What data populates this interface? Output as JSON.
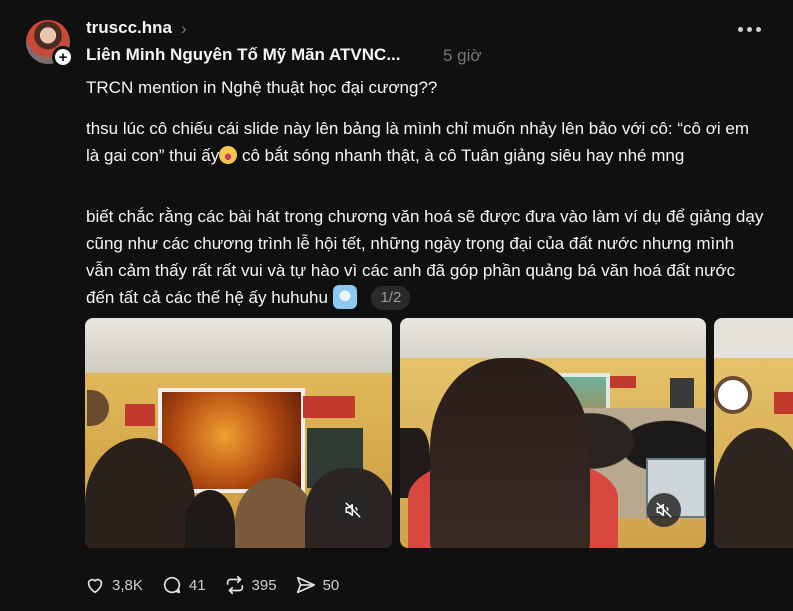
{
  "post": {
    "username": "truscc.hna",
    "community": "Liên Minh Nguyên Tố Mỹ Mãn ATVNC...",
    "time": "5 giờ",
    "paragraphs": {
      "p1": "TRCN mention in Nghệ thuật học đại cương??",
      "p2a": "thsu lúc cô chiếu cái slide này lên bảng là mình chỉ muốn nhảy lên bảo với cô: “cô ơi em là gai con” thui ấy",
      "p2b": " cô bắt sóng nhanh thật, à cô Tuân giảng siêu hay nhé mng",
      "p3": "biết chắc rằng các bài hát trong chương văn hoá sẽ được đưa vào làm ví dụ để giảng dạy cũng như các chương trình lễ hội tết, những ngày trọng đại của đất nước nhưng mình vẫn cảm thấy rất rất vui và tự hào vì các anh đã góp phần quảng bá văn hoá đất nước đến tất cả các thế hệ ấy huhuhu"
    },
    "pager": "1/2",
    "stats": {
      "likes": "3,8K",
      "comments": "41",
      "reposts": "395",
      "shares": "50"
    }
  },
  "icons": {
    "more": "more-horizontal-icon",
    "follow": "plus-icon",
    "chevron": "chevron-right-icon",
    "mute": "muted-speaker-icon",
    "like": "heart-icon",
    "comment": "speech-bubble-icon",
    "repost": "repost-icon",
    "share": "paper-plane-icon"
  },
  "colors": {
    "background": "#101010",
    "text": "#f3f5f7",
    "muted": "#777777"
  }
}
